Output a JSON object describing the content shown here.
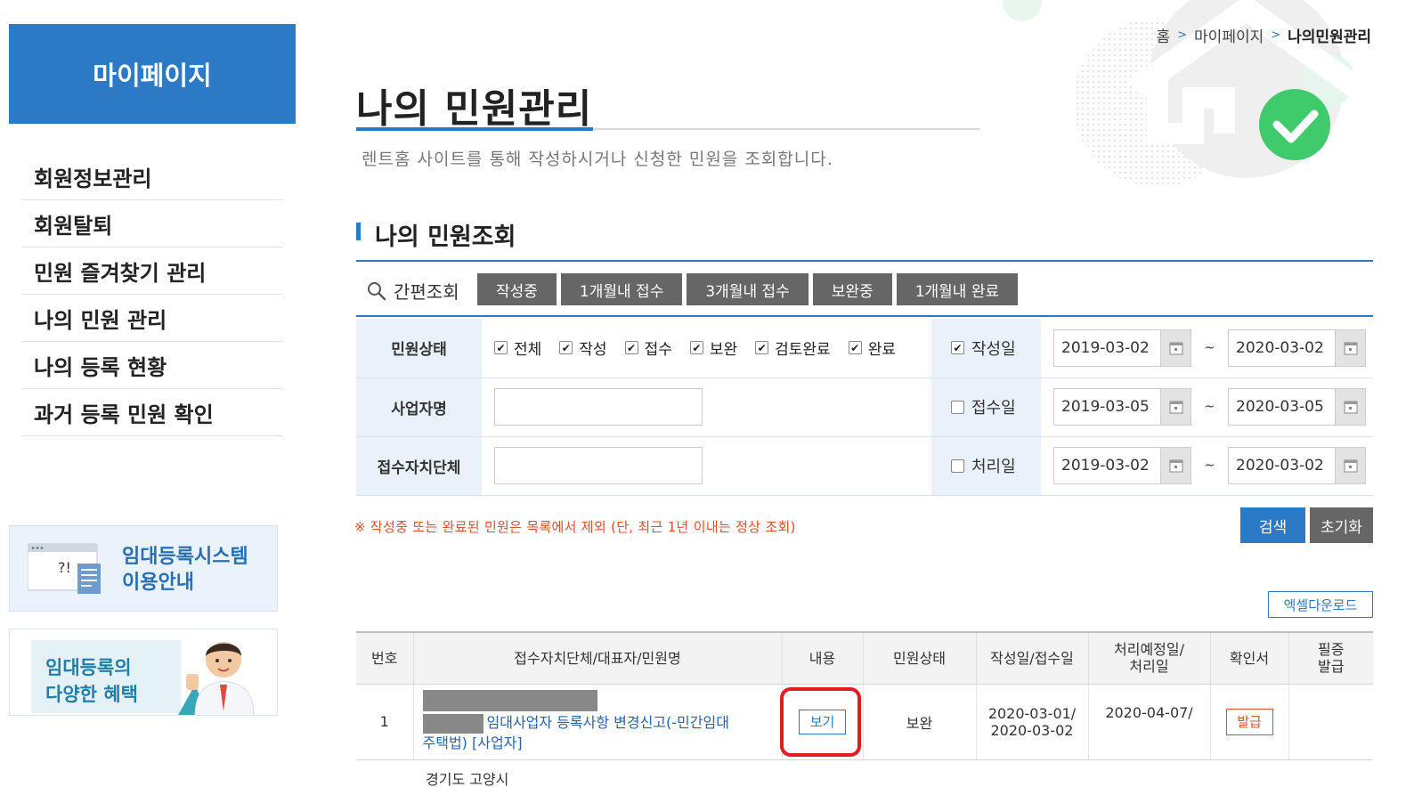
{
  "sidebar": {
    "header": "마이페이지",
    "items": [
      {
        "label": "회원정보관리"
      },
      {
        "label": "회원탈퇴"
      },
      {
        "label": "민원 즐겨찾기 관리"
      },
      {
        "label": "나의 민원 관리"
      },
      {
        "label": "나의 등록 현황"
      },
      {
        "label": "과거 등록 민원 확인"
      }
    ],
    "banner_guide": {
      "line1": "임대등록시스템",
      "line2": "이용안내",
      "icon": "document-question-icon"
    },
    "banner_benefit": {
      "line1": "임대등록의",
      "line2": "다양한 혜택",
      "icon": "person-thumbs-up-icon"
    }
  },
  "breadcrumb": {
    "items": [
      "홈",
      "마이페이지",
      "나의민원관리"
    ],
    "separator": ">"
  },
  "page": {
    "title": "나의 민원관리",
    "description": "렌트홈 사이트를 통해 작성하시거나 신청한 민원을 조회합니다."
  },
  "section": {
    "title": "나의 민원조회"
  },
  "quick_search": {
    "label": "간편조회",
    "icon": "search-icon",
    "buttons": [
      "작성중",
      "1개월내 접수",
      "3개월내 접수",
      "보완중",
      "1개월내 완료"
    ]
  },
  "form": {
    "status_label": "민원상태",
    "status_options": [
      {
        "label": "전체",
        "checked": true
      },
      {
        "label": "작성",
        "checked": true
      },
      {
        "label": "접수",
        "checked": true
      },
      {
        "label": "보완",
        "checked": true
      },
      {
        "label": "검토완료",
        "checked": true
      },
      {
        "label": "완료",
        "checked": true
      }
    ],
    "business_label": "사업자명",
    "business_value": "",
    "agency_label": "접수자치단체",
    "agency_value": "",
    "tilde": "~",
    "date_rows": [
      {
        "label": "작성일",
        "checked": true,
        "from": "2019-03-02",
        "to": "2020-03-02"
      },
      {
        "label": "접수일",
        "checked": false,
        "from": "2019-03-05",
        "to": "2020-03-05"
      },
      {
        "label": "처리일",
        "checked": false,
        "from": "2019-03-02",
        "to": "2020-03-02"
      }
    ]
  },
  "notice": "※ 작성중 또는 완료된 민원은 목록에서 제외 (단, 최근 1년 이내는 정상 조회)",
  "buttons": {
    "search": "검색",
    "reset": "초기화",
    "excel": "엑셀다운로드"
  },
  "table": {
    "headers": {
      "no": "번호",
      "name": "접수자치단체/대표자/민원명",
      "content": "내용",
      "status": "민원상태",
      "dates": "작성일/접수일",
      "due_line1": "처리예정일/",
      "due_line2": "처리일",
      "cert": "확인서",
      "must_line1": "필증",
      "must_line2": "발급"
    },
    "rows": [
      {
        "no": "1",
        "name_line1": "임대사업자 등록사항 변경신고(-민간임대",
        "name_line2": "주택법) [사업자]",
        "view": "보기",
        "status": "보완",
        "written": "2020-03-01/",
        "received": "2020-03-02",
        "due": "2020-04-07/",
        "cert": "발급",
        "must": ""
      }
    ],
    "next_row_partial": "경기도 고양시"
  },
  "colors": {
    "brand_blue": "#2c7ac6",
    "notice_red": "#e0502b",
    "highlight_red": "#e31b23",
    "button_gray": "#666666"
  }
}
